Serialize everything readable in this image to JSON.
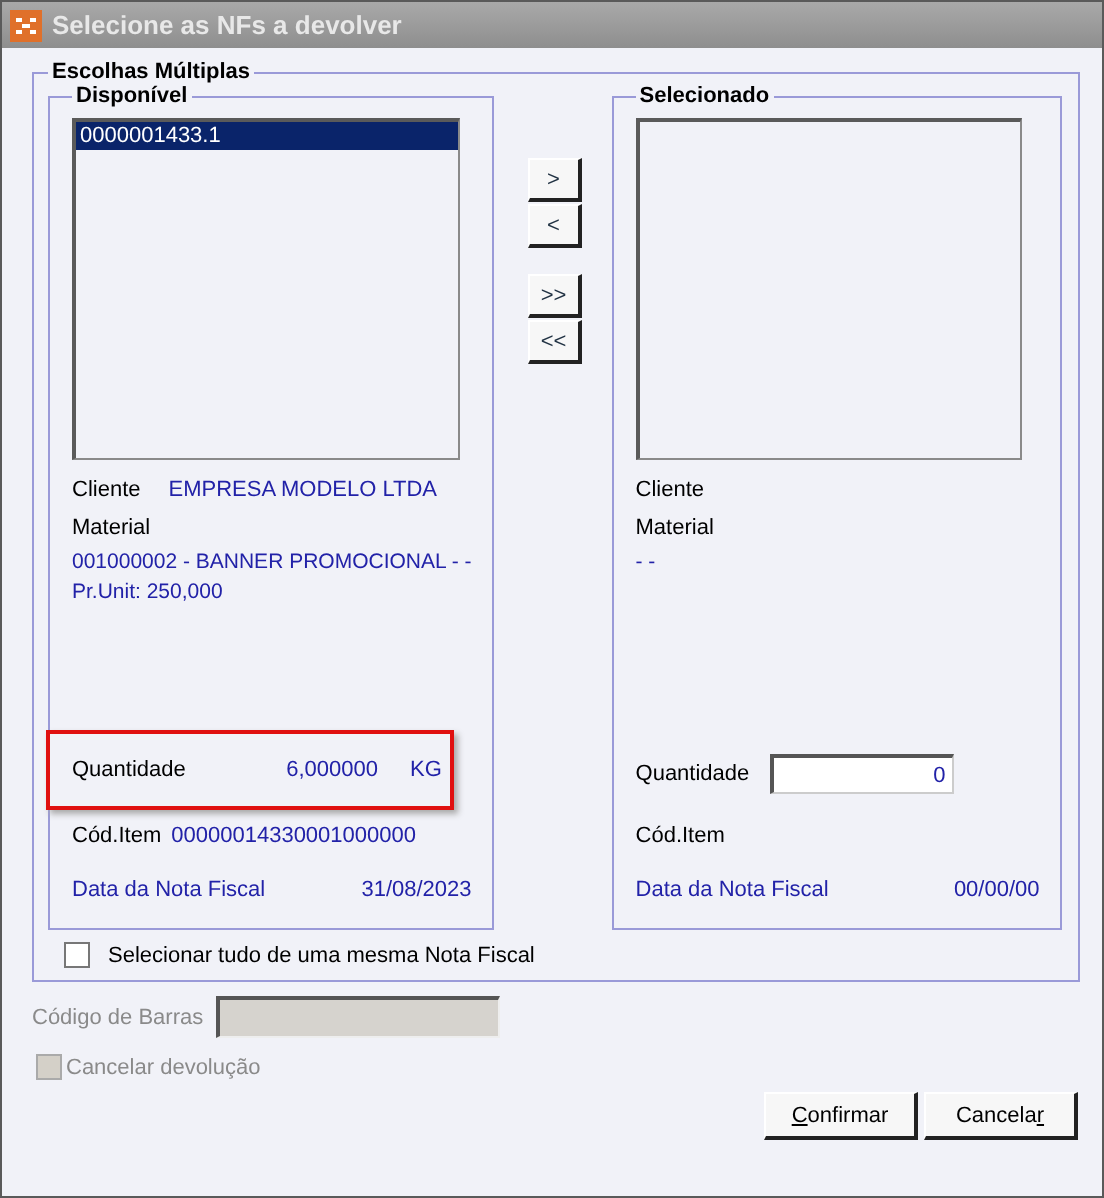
{
  "window": {
    "title": "Selecione as NFs a devolver"
  },
  "group": {
    "title": "Escolhas Múltiplas"
  },
  "panels": [
    {
      "title": "Disponível",
      "items": [
        {
          "text": "0000001433.1",
          "selected": true
        }
      ],
      "cliente_label": "Cliente",
      "cliente": "EMPRESA MODELO LTDA",
      "material_label": "Material",
      "material": "001000002 - BANNER PROMOCIONAL -  -",
      "price": "Pr.Unit: 250,000",
      "quantidade_label": "Quantidade",
      "quantidade": {
        "kind": "text",
        "value": "6,000000",
        "unit": "KG"
      },
      "highlighted": true,
      "cod_label": "Cód.Item",
      "cod": "00000014330001000000",
      "data_label": "Data da Nota Fiscal",
      "data": "31/08/2023"
    },
    {
      "title": "Selecionado",
      "cliente_label": "Cliente",
      "material_label": "Material",
      "material": "-  -",
      "quantidade_label": "Quantidade",
      "quantidade": {
        "kind": "field",
        "value": "0"
      },
      "highlighted": false,
      "cod_label": "Cód.Item",
      "data_label": "Data da Nota Fiscal",
      "data": "00/00/00"
    }
  ],
  "transfer_buttons": [
    [
      ">",
      "<"
    ],
    [
      ">>",
      "<<"
    ]
  ],
  "select_all": {
    "label": "Selecionar tudo de uma mesma Nota Fiscal",
    "checked": false
  },
  "barcode": {
    "label": "Código de Barras",
    "disabled": true
  },
  "cancel_return": {
    "label": "Cancelar devolução",
    "checked": false,
    "disabled": true
  },
  "buttons": [
    {
      "label": [
        {
          "text": "C",
          "underlined": true
        },
        {
          "text": "onfirmar",
          "underlined": false
        }
      ]
    },
    {
      "label": [
        {
          "text": "Cancela",
          "underlined": false
        },
        {
          "text": "r",
          "underlined": true
        }
      ]
    }
  ]
}
